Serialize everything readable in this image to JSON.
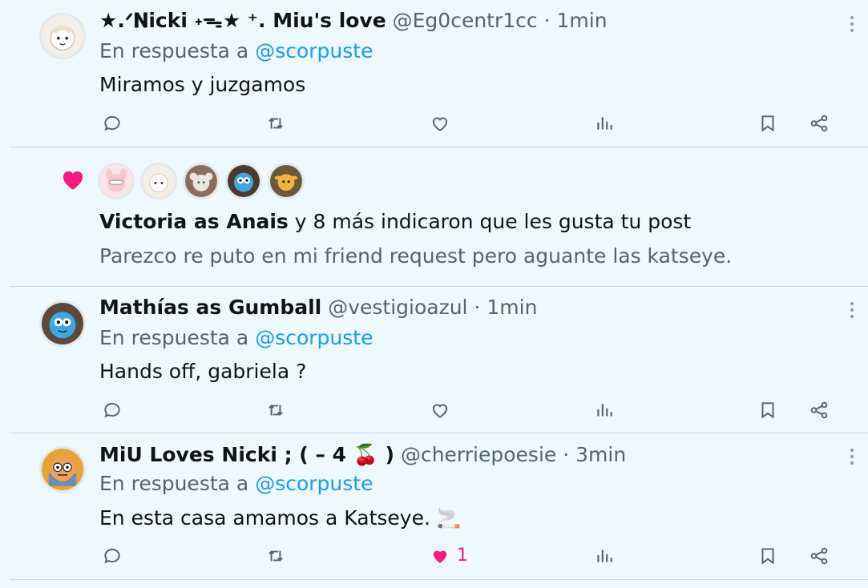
{
  "posts": [
    {
      "name": "★.ᐟ𝐍icki ˖ᯓ★ ⁺. Miu's love",
      "handle": "@Eg0centr1cc",
      "time": "1min",
      "reply_prefix": "En respuesta a",
      "reply_to": "@scorpuste",
      "text": "Miramos y juzgamos",
      "like_count": ""
    },
    {
      "name": "Mathías as Gumball",
      "handle": "@vestigioazul",
      "time": "1min",
      "reply_prefix": "En respuesta a",
      "reply_to": "@scorpuste",
      "text": "Hands off, gabriela ?",
      "like_count": ""
    },
    {
      "name": "MiU Loves Nicki ; ( – 4 🍒 )",
      "handle": "@cherriepoesie",
      "time": "3min",
      "reply_prefix": "En respuesta a",
      "reply_to": "@scorpuste",
      "text": "En esta casa amamos a Katseye. 🚬",
      "like_count": "1"
    }
  ],
  "separator": "·",
  "notification": {
    "actor": "Victoria as Anais",
    "rest": " y 8 más indicaron que les gusta tu post",
    "post_text": "Parezco re puto en mi friend request pero aguante las katseye."
  },
  "icons": {
    "reply": "reply-icon",
    "repost": "repost-icon",
    "like": "heart-icon",
    "views": "analytics-icon",
    "bookmark": "bookmark-icon",
    "share": "share-icon",
    "more": "more-icon"
  },
  "colors": {
    "background": "#eef8ff",
    "accent": "#1d9bf0",
    "like": "#f91880",
    "muted": "#536471"
  }
}
